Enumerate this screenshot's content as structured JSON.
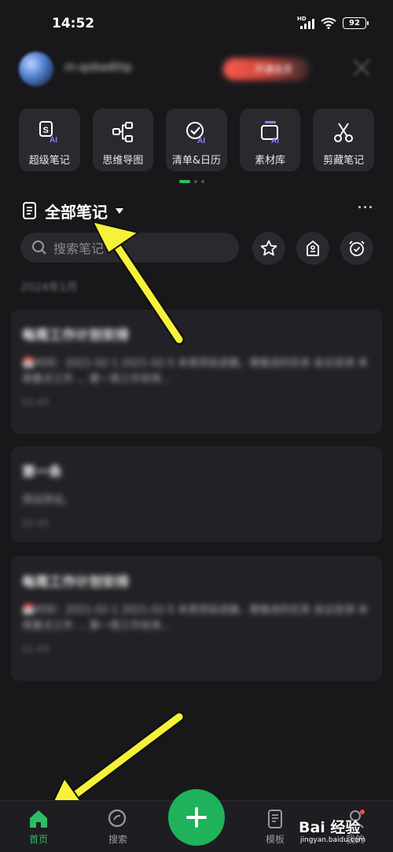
{
  "status_bar": {
    "time": "14:52",
    "network": "HD",
    "battery": "92"
  },
  "profile": {
    "username": "m-qobadthp",
    "vip_label": "开通会员"
  },
  "tools": [
    {
      "label": "超级笔记",
      "icon": "super-note-icon"
    },
    {
      "label": "思维导图",
      "icon": "mind-map-icon"
    },
    {
      "label": "清单&日历",
      "icon": "checklist-calendar-icon"
    },
    {
      "label": "素材库",
      "icon": "material-library-icon"
    },
    {
      "label": "剪藏笔记",
      "icon": "clip-note-icon"
    }
  ],
  "pager": {
    "active_index": 0,
    "count": 3
  },
  "section": {
    "title": "全部笔记"
  },
  "search": {
    "placeholder": "搜索笔记"
  },
  "month_header": "2024年1月",
  "notes": [
    {
      "title": "每周工作计划安排",
      "body": "📅时间：2021-02-1 2021-02-5 本周项目进展，需推进的任务 会议安排 本周重点工作 ... 第一周工作安排...",
      "date": "01-05"
    },
    {
      "title": "第一条",
      "body": "测试测试。",
      "date": "01-05"
    },
    {
      "title": "每周工作计划安排",
      "body": "📅时间：2021-02-1 2021-02-5 本周项目进展，需推进的任务 会议安排 本周重点工作 ... 第一周工作安排...",
      "date": "01-05"
    }
  ],
  "bottom_nav": {
    "home": "首页",
    "search": "搜索",
    "templates": "模板",
    "mine": "我的"
  },
  "watermark": {
    "brand": "Bai 经验",
    "url": "jingyan.baidu.com"
  },
  "colors": {
    "accent": "#2ebd64",
    "background": "#18181b",
    "card": "#222226",
    "annotation_arrow": "#f6f23a"
  }
}
